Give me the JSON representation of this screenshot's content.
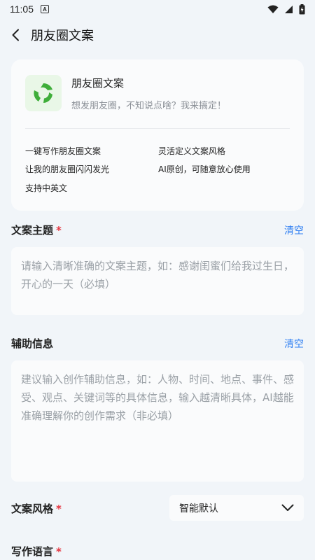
{
  "status_bar": {
    "time": "11:05",
    "badge": "A"
  },
  "header": {
    "title": "朋友圈文案"
  },
  "app_card": {
    "name": "朋友圈文案",
    "description": "想发朋友圈，不知说点啥？我来搞定！",
    "features": [
      "一键写作朋友圈文案",
      "灵活定义文案风格",
      "让我的朋友圈闪闪发光",
      "AI原创，可随意放心使用",
      "支持中英文"
    ]
  },
  "topic": {
    "label": "文案主题",
    "required_mark": "*",
    "clear_label": "清空",
    "placeholder": "请输入清晰准确的文案主题，如：感谢闺蜜们给我过生日，开心的一天（必填）"
  },
  "aux": {
    "label": "辅助信息",
    "clear_label": "清空",
    "placeholder": "建议输入创作辅助信息，如：人物、时间、地点、事件、感受、观点、关键词等的具体信息，输入越清晰具体，AI越能准确理解你的创作需求（非必填）"
  },
  "style": {
    "label": "文案风格",
    "required_mark": "*",
    "selected": "智能默认"
  },
  "language": {
    "label": "写作语言",
    "required_mark": "*"
  },
  "colors": {
    "accent": "#2f7ff2",
    "required": "#e5343f",
    "logo_green": "#3fae3a"
  }
}
